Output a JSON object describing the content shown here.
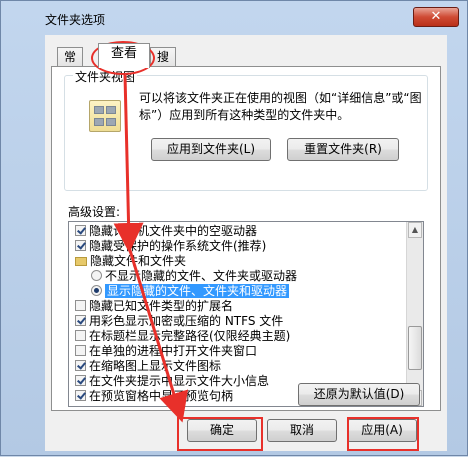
{
  "window": {
    "title": "文件夹选项",
    "close_glyph": "✕"
  },
  "tabs": [
    {
      "label": "常规"
    },
    {
      "label": "查看"
    },
    {
      "label": "搜索"
    }
  ],
  "folder_views": {
    "legend": "文件夹视图",
    "description": "可以将该文件夹正在使用的视图（如“详细信息”或“图标”）应用到所有这种类型的文件夹中。",
    "apply_button": "应用到文件夹(L)",
    "reset_button": "重置文件夹(R)"
  },
  "advanced": {
    "label": "高级设置:",
    "items": [
      {
        "type": "check",
        "checked": true,
        "text": "隐藏计算机文件夹中的空驱动器"
      },
      {
        "type": "check",
        "checked": true,
        "text": "隐藏受保护的操作系统文件(推荐)"
      },
      {
        "type": "folder",
        "text": "隐藏文件和文件夹"
      },
      {
        "type": "radio",
        "checked": false,
        "text": "不显示隐藏的文件、文件夹或驱动器"
      },
      {
        "type": "radio",
        "checked": true,
        "text": "显示隐藏的文件、文件夹和驱动器",
        "selected": true
      },
      {
        "type": "check",
        "checked": false,
        "text": "隐藏已知文件类型的扩展名"
      },
      {
        "type": "check",
        "checked": true,
        "text": "用彩色显示加密或压缩的 NTFS 文件"
      },
      {
        "type": "check",
        "checked": false,
        "text": "在标题栏显示完整路径(仅限经典主题)"
      },
      {
        "type": "check",
        "checked": false,
        "text": "在单独的进程中打开文件夹窗口"
      },
      {
        "type": "check",
        "checked": true,
        "text": "在缩略图上显示文件图标"
      },
      {
        "type": "check",
        "checked": true,
        "text": "在文件夹提示中显示文件大小信息"
      },
      {
        "type": "check",
        "checked": true,
        "text": "在预览窗格中显示预览句柄"
      }
    ],
    "restore_button": "还原为默认值(D)"
  },
  "footer": {
    "ok": "确定",
    "cancel": "取消",
    "apply": "应用(A)"
  },
  "colors": {
    "annotation": "#e8302a",
    "selection": "#3399ff"
  }
}
